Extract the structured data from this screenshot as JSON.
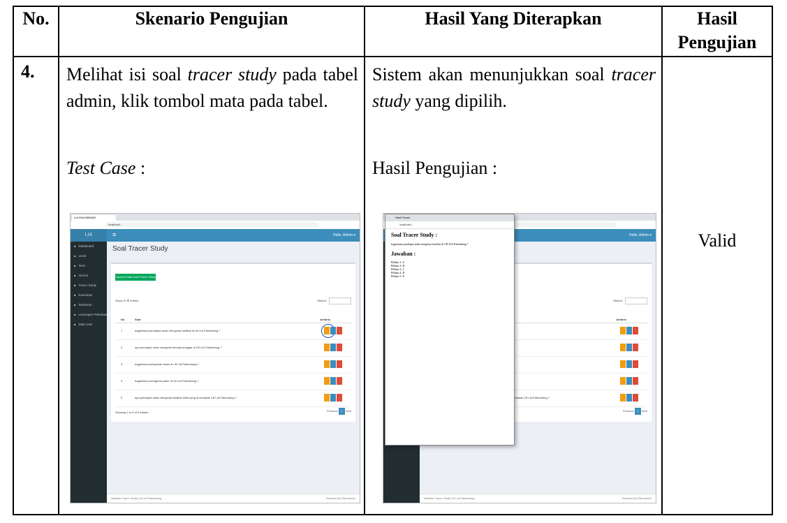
{
  "headers": {
    "no": "No.",
    "skenario": "Skenario Pengujian",
    "hasil_diterapkan": "Hasil Yang Diterapkan",
    "hasil_pengujian": "Hasil Pengujian"
  },
  "row": {
    "number": "4.",
    "scenario_part1": "Melihat isi soal ",
    "scenario_italic": "tracer study",
    "scenario_part2": " pada tabel admin, klik tombol mata pada tabel.",
    "test_case_label": "Test Case",
    "test_case_colon": " :",
    "expected_part1": "Sistem akan menunjukkan soal ",
    "expected_italic": "tracer study",
    "expected_part2": " yang dipilih.",
    "result_label": "Hasil Pengujian :",
    "result_value": "Valid"
  },
  "screenshot": {
    "tab_title": "LIA PALEMBANG",
    "url": "localhost/...",
    "brand": "LIA PALEMBANG",
    "hello": "Hello, Admin ▾",
    "page_title": "Soal Tracer Study",
    "add_button": "Tambah Data Soal Tracer Study",
    "show_entries": "Show 10 ⬍ entries",
    "search_label": "Search:",
    "col_no": "No",
    "col_soal": "Soal",
    "col_actions": "Actions",
    "sidebar": [
      "Dashboard",
      "Level",
      "Term",
      "Alumni",
      "Tracer Study",
      "Kuesioner",
      "Testimoni",
      "Lowongan Pekerjaan",
      "Data User"
    ],
    "questions": [
      "bagaimana pendapat anda mengenai fasilitas di LB LIA Palembang ?",
      "apa pendapat anda mengenai kinerja pengajar di LB LIA Palembang ?",
      "bagaimana pelayanan staes di LB LIA Palembang ?",
      "bagaimana mengenai parkir di LB LIA Palembang ?",
      "apa pendapat anda mengenai fasilitas toilet yang di sediakan LB LIA Palembang ?"
    ],
    "showing": "Showing 1 to 5 of 5 entries",
    "prev": "Previous",
    "page": "1",
    "next": "Next",
    "footer_left": "Website Tracer Study LB LIA Palembang",
    "footer_right": "Powered by Pika Admin"
  },
  "popup": {
    "tab_title": "Hasil Tracer",
    "url": "localhost/...",
    "heading": "Soal Tracer Study :",
    "question": "bagaimana pendapat anda mengenai fasilitas di LB LIA Palembang ?",
    "jawaban": "Jawaban :",
    "options": [
      "Pilihan 1: A",
      "Pilihan 2: B",
      "Pilihan 3: C",
      "Pilihan 4: D",
      "Pilihan 5: E"
    ]
  }
}
